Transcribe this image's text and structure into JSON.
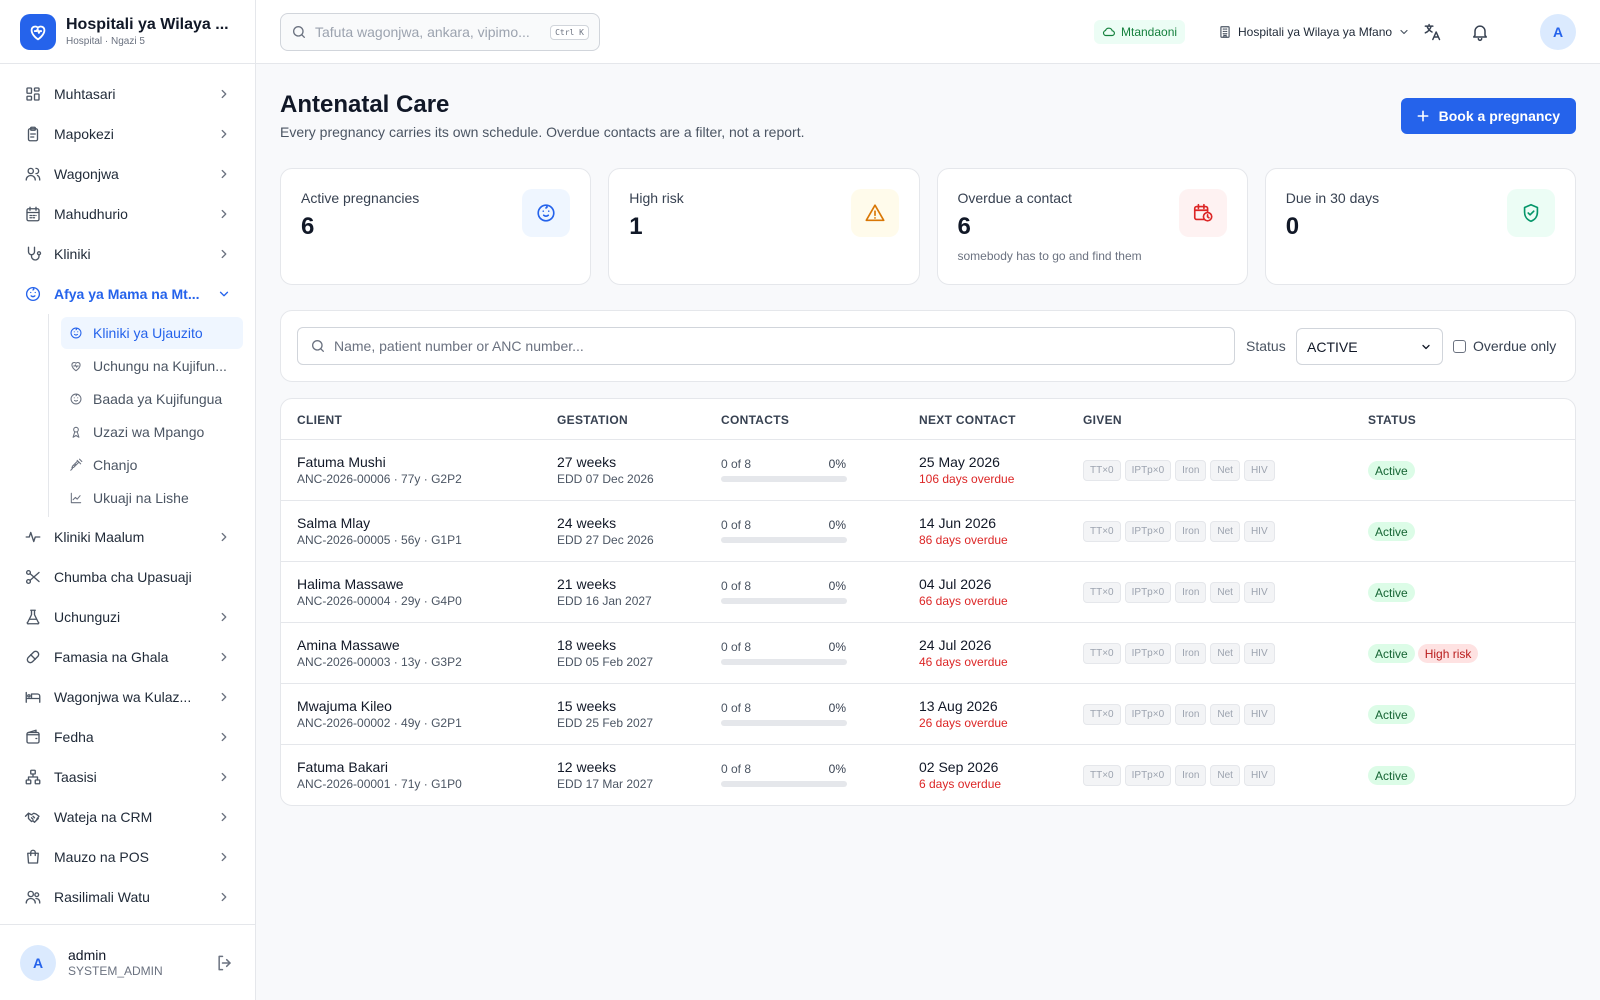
{
  "brand": {
    "name": "Hospitali ya Wilaya ...",
    "subtitle": "Hospital · Ngazi 5"
  },
  "sidebar": {
    "items": [
      {
        "label": "Muhtasari",
        "icon": "dashboard-grid-icon"
      },
      {
        "label": "Mapokezi",
        "icon": "clipboard-icon"
      },
      {
        "label": "Wagonjwa",
        "icon": "users-icon"
      },
      {
        "label": "Mahudhurio",
        "icon": "calendar-icon"
      },
      {
        "label": "Kliniki",
        "icon": "stethoscope-icon"
      }
    ],
    "active_group": {
      "label": "Afya ya Mama na Mt...",
      "children": [
        {
          "label": "Kliniki ya Ujauzito",
          "icon": "baby-face-icon",
          "active": true
        },
        {
          "label": "Uchungu na Kujifun...",
          "icon": "heart-pulse-icon"
        },
        {
          "label": "Baada ya Kujifungua",
          "icon": "baby-face-icon"
        },
        {
          "label": "Uzazi wa Mpango",
          "icon": "ribbon-icon"
        },
        {
          "label": "Chanjo",
          "icon": "syringe-icon"
        },
        {
          "label": "Ukuaji na Lishe",
          "icon": "growth-chart-icon"
        }
      ]
    },
    "items_after": [
      {
        "label": "Kliniki Maalum",
        "icon": "activity-icon",
        "chevron": true
      },
      {
        "label": "Chumba cha Upasuaji",
        "icon": "scissors-icon",
        "chevron": false
      },
      {
        "label": "Uchunguzi",
        "icon": "flask-icon",
        "chevron": true
      },
      {
        "label": "Famasia na Ghala",
        "icon": "pill-icon",
        "chevron": true
      },
      {
        "label": "Wagonjwa wa Kulaz...",
        "icon": "bed-icon",
        "chevron": true
      },
      {
        "label": "Fedha",
        "icon": "wallet-icon",
        "chevron": true
      },
      {
        "label": "Taasisi",
        "icon": "org-network-icon",
        "chevron": true
      },
      {
        "label": "Wateja na CRM",
        "icon": "handshake-icon",
        "chevron": true
      },
      {
        "label": "Mauzo na POS",
        "icon": "shopping-bag-icon",
        "chevron": true
      },
      {
        "label": "Rasilimali Watu",
        "icon": "people-icon",
        "chevron": true
      }
    ]
  },
  "user": {
    "initial": "A",
    "name": "admin",
    "role": "SYSTEM_ADMIN"
  },
  "topbar": {
    "search_placeholder": "Tafuta wagonjwa, ankara, vipimo...",
    "shortcut": "Ctrl K",
    "online_label": "Mtandaoni",
    "facility": "Hospitali ya Wilaya ya Mfano",
    "avatar_initial": "A"
  },
  "page": {
    "title": "Antenatal Care",
    "subtitle": "Every pregnancy carries its own schedule. Overdue contacts are a filter, not a report.",
    "primary_action": "Book a pregnancy"
  },
  "stats": [
    {
      "label": "Active pregnancies",
      "value": "6",
      "note": "",
      "icon": "baby-face-icon",
      "color": "#2563eb",
      "bg": "#eff6ff"
    },
    {
      "label": "High risk",
      "value": "1",
      "note": "",
      "icon": "warning-triangle-icon",
      "color": "#d97706",
      "bg": "#fffbeb"
    },
    {
      "label": "Overdue a contact",
      "value": "6",
      "note": "somebody has to go and find them",
      "icon": "calendar-clock-icon",
      "color": "#dc2626",
      "bg": "#fef2f2"
    },
    {
      "label": "Due in 30 days",
      "value": "0",
      "note": "",
      "icon": "shield-check-icon",
      "color": "#059669",
      "bg": "#ecfdf5"
    }
  ],
  "filters": {
    "search_placeholder": "Name, patient number or ANC number...",
    "status_label": "Status",
    "status_value": "ACTIVE",
    "overdue_label": "Overdue only"
  },
  "table": {
    "columns": [
      {
        "key": "client",
        "label": "CLIENT"
      },
      {
        "key": "gestation",
        "label": "GESTATION"
      },
      {
        "key": "contacts",
        "label": "CONTACTS"
      },
      {
        "key": "next",
        "label": "NEXT CONTACT"
      },
      {
        "key": "given",
        "label": "GIVEN"
      },
      {
        "key": "status",
        "label": "STATUS"
      }
    ],
    "rows": [
      {
        "name": "Fatuma Mushi",
        "meta": "ANC-2026-00006 · 77y · G2P2",
        "weeks": "27 weeks",
        "edd": "EDD 07 Dec 2026",
        "contacts": "0 of 8",
        "pct": "0%",
        "progress": 0,
        "next": "25 May 2026",
        "overdue": "106 days overdue",
        "given": [
          "TT×0",
          "IPTp×0",
          "Iron",
          "Net",
          "HIV"
        ],
        "badges": [
          {
            "label": "Active",
            "kind": "active"
          }
        ]
      },
      {
        "name": "Salma Mlay",
        "meta": "ANC-2026-00005 · 56y · G1P1",
        "weeks": "24 weeks",
        "edd": "EDD 27 Dec 2026",
        "contacts": "0 of 8",
        "pct": "0%",
        "progress": 0,
        "next": "14 Jun 2026",
        "overdue": "86 days overdue",
        "given": [
          "TT×0",
          "IPTp×0",
          "Iron",
          "Net",
          "HIV"
        ],
        "badges": [
          {
            "label": "Active",
            "kind": "active"
          }
        ]
      },
      {
        "name": "Halima Massawe",
        "meta": "ANC-2026-00004 · 29y · G4P0",
        "weeks": "21 weeks",
        "edd": "EDD 16 Jan 2027",
        "contacts": "0 of 8",
        "pct": "0%",
        "progress": 0,
        "next": "04 Jul 2026",
        "overdue": "66 days overdue",
        "given": [
          "TT×0",
          "IPTp×0",
          "Iron",
          "Net",
          "HIV"
        ],
        "badges": [
          {
            "label": "Active",
            "kind": "active"
          }
        ]
      },
      {
        "name": "Amina Massawe",
        "meta": "ANC-2026-00003 · 13y · G3P2",
        "weeks": "18 weeks",
        "edd": "EDD 05 Feb 2027",
        "contacts": "0 of 8",
        "pct": "0%",
        "progress": 0,
        "next": "24 Jul 2026",
        "overdue": "46 days overdue",
        "given": [
          "TT×0",
          "IPTp×0",
          "Iron",
          "Net",
          "HIV"
        ],
        "badges": [
          {
            "label": "Active",
            "kind": "active"
          },
          {
            "label": "High risk",
            "kind": "risk"
          }
        ]
      },
      {
        "name": "Mwajuma Kileo",
        "meta": "ANC-2026-00002 · 49y · G2P1",
        "weeks": "15 weeks",
        "edd": "EDD 25 Feb 2027",
        "contacts": "0 of 8",
        "pct": "0%",
        "progress": 0,
        "next": "13 Aug 2026",
        "overdue": "26 days overdue",
        "given": [
          "TT×0",
          "IPTp×0",
          "Iron",
          "Net",
          "HIV"
        ],
        "badges": [
          {
            "label": "Active",
            "kind": "active"
          }
        ]
      },
      {
        "name": "Fatuma Bakari",
        "meta": "ANC-2026-00001 · 71y · G1P0",
        "weeks": "12 weeks",
        "edd": "EDD 17 Mar 2027",
        "contacts": "0 of 8",
        "pct": "0%",
        "progress": 0,
        "next": "02 Sep 2026",
        "overdue": "6 days overdue",
        "given": [
          "TT×0",
          "IPTp×0",
          "Iron",
          "Net",
          "HIV"
        ],
        "badges": [
          {
            "label": "Active",
            "kind": "active"
          }
        ]
      }
    ]
  }
}
